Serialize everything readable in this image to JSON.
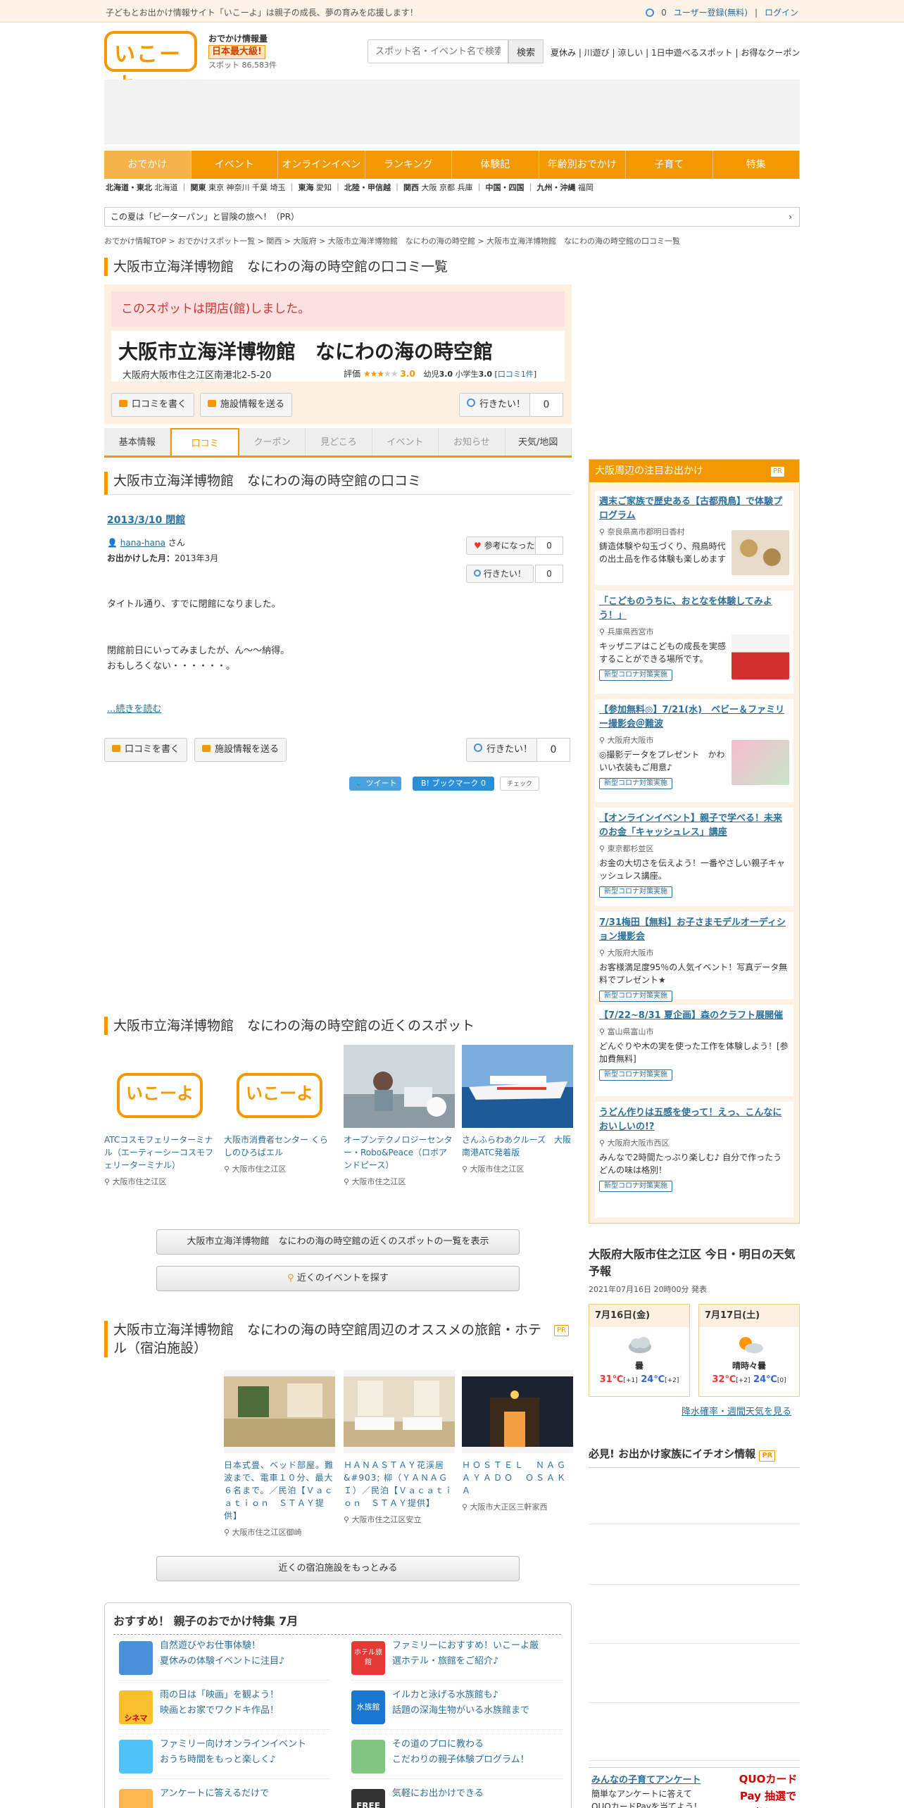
{
  "topbar": {
    "message": "子どもとお出かけ情報サイト「いこーよ」は親子の成長、夢の育みを応援します！",
    "clip_count": "0",
    "register": "ユーザー登録(無料)",
    "login": "ログイン"
  },
  "logo": {
    "text": "いこーよ",
    "tagline": "おでかけ情報量",
    "badge": "日本最大級!",
    "spots_label": "スポット",
    "spots_count": "86,583件"
  },
  "search": {
    "placeholder": "スポット名・イベント名で検索",
    "button": "検索"
  },
  "quick_links": "夏休み | 川遊び | 涼しい | 1日中遊べるスポット | お得なクーポン",
  "nav": [
    "おでかけ",
    "イベント",
    "オンラインイベント",
    "ランキング",
    "体験記",
    "年齢別おでかけ",
    "子育て",
    "特集"
  ],
  "regions": [
    {
      "name": "北海道・東北",
      "items": "北海道"
    },
    {
      "name": "関東",
      "items": "東京 神奈川 千葉 埼玉"
    },
    {
      "name": "東海",
      "items": "愛知"
    },
    {
      "name": "北陸・甲信越",
      "items": ""
    },
    {
      "name": "関西",
      "items": "大阪 京都 兵庫"
    },
    {
      "name": "中国・四国",
      "items": ""
    },
    {
      "name": "九州・沖縄",
      "items": "福岡"
    }
  ],
  "banner": "この夏は「ピーターパン」と冒険の旅へ！（PR）",
  "breadcrumb": "おでかけ情報TOP > おでかけスポット一覧 > 関西 > 大阪府 > 大阪市立海洋博物館　なにわの海の時空館 > 大阪市立海洋博物館　なにわの海の時空館の口コミ一覧",
  "page_title": "大阪市立海洋博物館　なにわの海の時空館の口コミ一覧",
  "spot": {
    "closed_notice": "このスポットは閉店(館)しました。",
    "name": "大阪市立海洋博物館　なにわの海の時空館",
    "address": "大阪府大阪市住之江区南港北2-5-20",
    "rating_label": "評価",
    "rating": "3.0",
    "rating_value": 3,
    "infant_label": "幼児",
    "infant": "3.0",
    "elem_label": "小学生",
    "elem": "3.0",
    "review_link": "口コミ1件"
  },
  "actions": {
    "write_review": "口コミを書く",
    "send_info": "施設情報を送る",
    "want_go": "行きたい！",
    "want_count": "0"
  },
  "tabs": [
    "基本情報",
    "口コミ",
    "クーポン",
    "見どころ",
    "イベント",
    "お知らせ",
    "天気/地図"
  ],
  "review_section_title": "大阪市立海洋博物館　なにわの海の時空館の口コミ",
  "review": {
    "date_title": "2013/3/10 閉館",
    "user": "hana-hana",
    "suffix": "さん",
    "visit_label": "お出かけした月：",
    "visit": "2013年3月",
    "helpful": "参考になった",
    "helpful_count": "0",
    "want_go": "行きたい！",
    "want_count": "0",
    "body": "タイトル通り、すでに閉館になりました。\n\n\n閉館前日にいってみましたが、ん～～納得。\nおもしろくない・・・・・・。",
    "more": "...続きを読む"
  },
  "social": {
    "tweet": "ツイート",
    "hatena": "B! ブックマーク",
    "hatena_count": "0",
    "check": "チェック"
  },
  "nearby_title": "大阪市立海洋博物館　なにわの海の時空館の近くのスポット",
  "nearby": [
    {
      "name": "ATCコスモフェリーターミナル（エーティーシーコスモフェリーターミナル）",
      "loc": "大阪市住之江区",
      "logo": "いこーよ"
    },
    {
      "name": "大阪市消費者センター くらしのひろばエル",
      "loc": "大阪市住之江区",
      "logo": "いこーよ"
    },
    {
      "name": "オープンテクノロジーセンター・Robo&Peace（ロボアンドピース）",
      "loc": "大阪市住之江区"
    },
    {
      "name": "さんふらわあクルーズ　大阪南港ATC発着版",
      "loc": "大阪市住之江区"
    }
  ],
  "nearby_list_btn": "大阪市立海洋博物館　なにわの海の時空館の近くのスポットの一覧を表示",
  "nearby_events_btn": "近くのイベントを探す",
  "hotel_title": "大阪市立海洋博物館　なにわの海の時空館周辺のオススメの旅館・ホテル（宿泊施設）",
  "pr_label": "PR",
  "hotels": [
    {
      "name": "日本式畳、ベッド部屋。難波まで、電車１０分、最大６名まで。／民泊【Ｖａｃａｔｉｏｎ　ＳＴＡＹ提供】",
      "loc": "大阪市住之江区御崎"
    },
    {
      "name": "ＨＡＮＡＳＴＡＹ花渓居　&#903; 柳（ＹＡＮＡＧＩ）／民泊【Ｖａｃａｔｉｏｎ　ＳＴＡＹ提供】",
      "loc": "大阪市住之江区安立"
    },
    {
      "name": "ＨＯＳＴＥＬ　ＮＡＧＡＹＡＤＯ　ＯＳＡＫＡ",
      "loc": "大阪市大正区三軒家西"
    }
  ],
  "hotel_more_btn": "近くの宿泊施設をもっとみる",
  "feature": {
    "title": "おすすめ！ 親子のおでかけ特集 7月",
    "items": [
      {
        "line1": "自然遊びやお仕事体験！",
        "line2": "夏休みの体験イベントに注目♪"
      },
      {
        "line1": "ファミリーにおすすめ！いこーよ厳",
        "line2": "選ホテル・旅館をご紹介♪"
      },
      {
        "line1": "雨の日は「映画」を観よう！",
        "line2": "映画とお家でワクドキ作品！"
      },
      {
        "line1": "イルカと泳げる水族館も♪",
        "line2": "話題の深海生物がいる水族館まで"
      },
      {
        "line1": "ファミリー向けオンラインイベント",
        "line2": "おうち時間をもっと楽しく♪"
      },
      {
        "line1": "その道のプロに教わる",
        "line2": "こだわりの親子体験プログラム！"
      },
      {
        "line1": "アンケートに答えるだけで",
        "line2": ""
      },
      {
        "line1": "気軽にお出かけできる",
        "line2": ""
      }
    ],
    "icon_labels": [
      "シネマ",
      "ホテル旅館",
      "水族館",
      "FREE"
    ]
  },
  "sidebar": {
    "title": "大阪周辺の注目お出かけ",
    "cards": [
      {
        "title": "週末ご家族で歴史ある【古都飛鳥】で体験プログラム",
        "loc": "奈良県高市郡明日香村",
        "desc": "鋳造体験や勾玉づくり、飛鳥時代の出土品を作る体験も楽しめます",
        "badge": ""
      },
      {
        "title": "「こどものうちに、おとなを体験してみよう！」",
        "loc": "兵庫県西宮市",
        "desc": "キッザニアはこどもの成長を実感することができる場所です。",
        "badge": "新型コロナ対策実施"
      },
      {
        "title": "【参加無料◎】7/21(水)　ベビー＆ファミリー撮影会＠難波",
        "loc": "大阪府大阪市",
        "desc": "◎撮影データをプレゼント　かわいい衣装もご用意♪",
        "badge": "新型コロナ対策実施"
      },
      {
        "title": "【オンラインイベント】親子で学べる！未来のお金「キャッシュレス」講座",
        "loc": "東京都杉並区",
        "desc": "お金の大切さを伝えよう！一番やさしい親子キャッシュレス講座。",
        "badge": "新型コロナ対策実施"
      },
      {
        "title": "7/31梅田【無料】お子さまモデルオーディション撮影会",
        "loc": "大阪府大阪市",
        "desc": "お客様満足度95％の人気イベント！写真データ無料でプレゼント★",
        "badge": "新型コロナ対策実施"
      },
      {
        "title": "【7/22~8/31 夏企画】森のクラフト展開催",
        "loc": "富山県富山市",
        "desc": "どんぐりや木の実を使った工作を体験しよう！[参加費無料]",
        "badge": "新型コロナ対策実施"
      },
      {
        "title": "うどん作りは五感を使って！えっ、こんなにおいしいの!?",
        "loc": "大阪府大阪市西区",
        "desc": "みんなで2時間たっぷり楽しむ♪ 自分で作ったうどんの味は格別！",
        "badge": "新型コロナ対策実施"
      }
    ]
  },
  "weather": {
    "title": "大阪府大阪市住之江区 今日・明日の天気予報",
    "date": "2021年07月16日 20時00分 発表",
    "days": [
      {
        "day": "7月16日(金)",
        "text": "曇",
        "high": "31℃",
        "high_diff": "[+1]",
        "low": "24℃",
        "low_diff": "[+2]"
      },
      {
        "day": "7月17日(土)",
        "text": "晴時々曇",
        "high": "32℃",
        "high_diff": "[+2]",
        "low": "24℃",
        "low_diff": "[0]"
      }
    ],
    "link": "降水確率・週間天気を見る"
  },
  "osusume_title": "必見! お出かけ家族にイチオシ情報",
  "survey": {
    "title": "みんなの子育てアンケート",
    "desc": "簡単なアンケートに答えて",
    "desc2": "QUOカードPayを当てよう！",
    "promo": "QUOカードPay 抽選で当たる"
  },
  "colors": {
    "accent": "#f39800",
    "link": "#2b6f9c",
    "closed": "#cc3333"
  }
}
